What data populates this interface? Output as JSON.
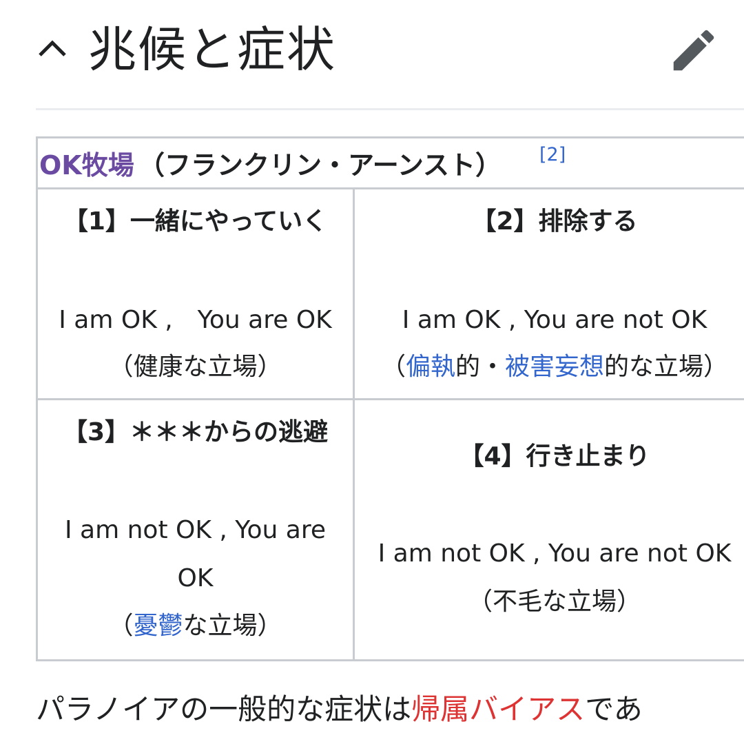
{
  "section": {
    "title": "兆候と症状"
  },
  "table": {
    "caption_link": "OK牧場",
    "caption_text": "（フランクリン・アーンスト）",
    "caption_ref": "[2]",
    "cells": [
      {
        "heading": "【1】一緒にやっていく",
        "ok_line": "I am OK ,　You are OK",
        "note_pre": "（健康な立場）"
      },
      {
        "heading": "【2】排除する",
        "ok_line": "I am OK , You are not OK",
        "note_open": "（",
        "link1": "偏執",
        "mid1": "的・",
        "link2": "被害妄想",
        "note_post": "的な立場）"
      },
      {
        "heading": "【3】＊＊＊からの逃避",
        "ok_line_a": "I am not OK , You are",
        "ok_line_b": "OK",
        "note_open": "（",
        "link1": "憂鬱",
        "note_post": "な立場）"
      },
      {
        "heading": "【4】行き止まり",
        "ok_line": "I am not OK , You are not OK",
        "note_pre": "（不毛な立場）"
      }
    ]
  },
  "paragraph": {
    "pre": "パラノイアの一般的な症状は",
    "link": "帰属バイアス",
    "post": "であ"
  },
  "colors": {
    "link_blue": "#3366cc",
    "visited_purple": "#6b4ba1",
    "redlink": "#dd3333",
    "border": "#c8ccd1"
  },
  "icons": [
    "chevron-up-icon",
    "pencil-icon"
  ]
}
